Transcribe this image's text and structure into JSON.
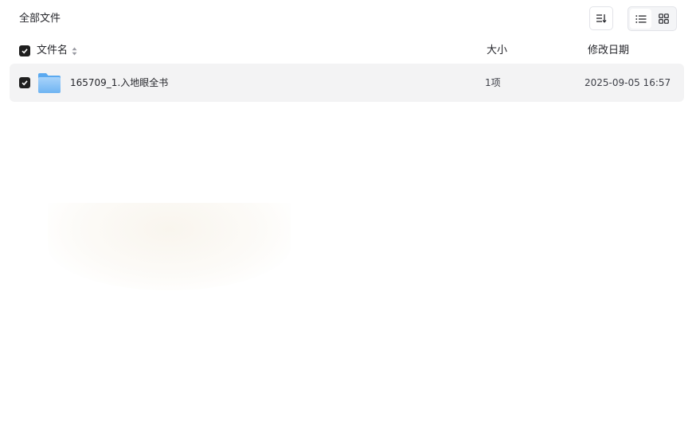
{
  "breadcrumb": {
    "title": "全部文件"
  },
  "toolbar": {
    "sort_icon": "sort-icon",
    "view_list_icon": "list-view-icon",
    "view_grid_icon": "grid-view-icon",
    "active_view": "list"
  },
  "table": {
    "columns": {
      "name": "文件名",
      "size": "大小",
      "modified": "修改日期"
    },
    "all_selected": true,
    "rows": [
      {
        "icon": "folder-icon",
        "name": "165709_1.入地眼全书",
        "size": "1项",
        "modified": "2025-09-05 16:57",
        "selected": true
      }
    ]
  },
  "colors": {
    "accent_checkbox": "#1f1f1f",
    "row_selected_bg": "#f3f3f4",
    "folder_light": "#9ccdf8",
    "folder_dark": "#5aa9f0"
  }
}
